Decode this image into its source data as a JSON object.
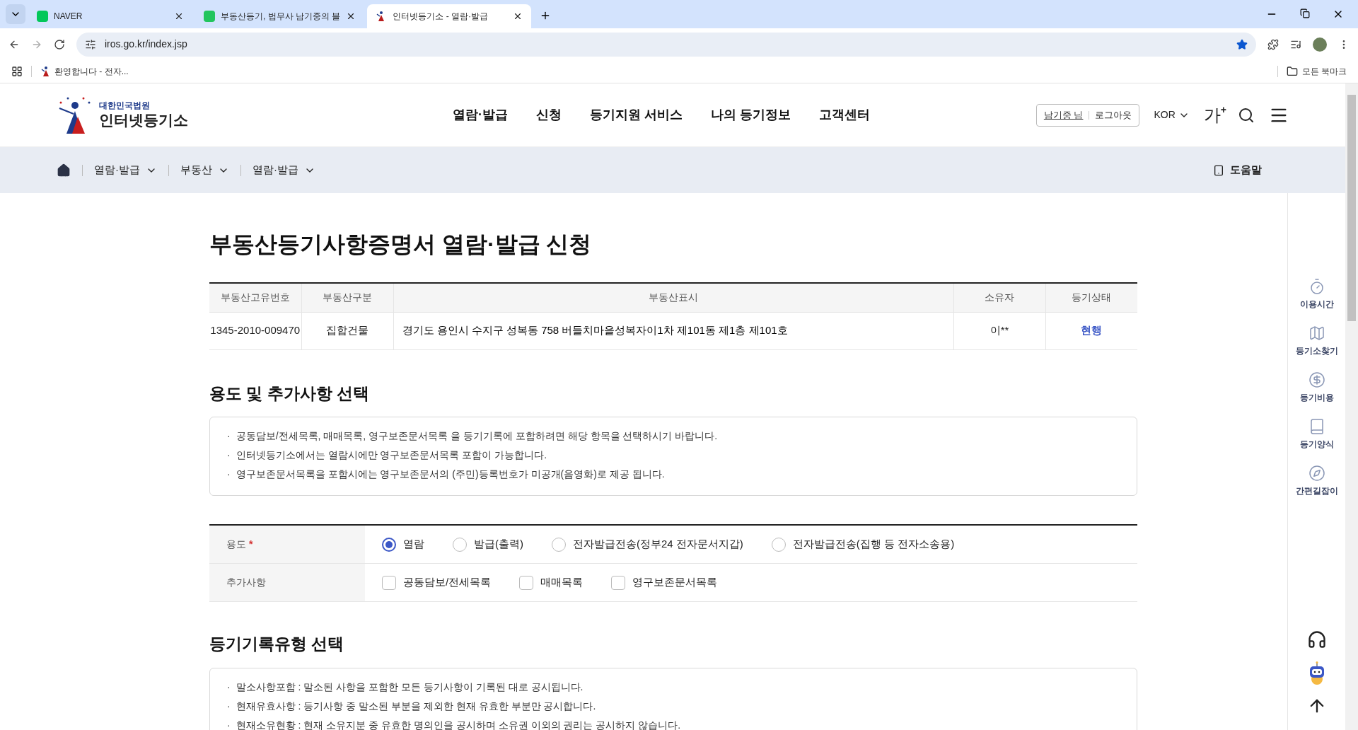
{
  "browser": {
    "tabs": [
      {
        "title": "NAVER",
        "selected": false,
        "kind": "naver"
      },
      {
        "title": "부동산등기, 법무사 남기중의 블",
        "selected": false,
        "kind": "blog"
      },
      {
        "title": "인터넷등기소 - 열람·발급",
        "selected": true,
        "kind": "site"
      }
    ],
    "address": "iros.go.kr/index.jsp",
    "bookmarks": [
      "환영합니다 - 전자..."
    ],
    "all_bookmarks": "모든 북마크"
  },
  "header": {
    "logo_small": "대한민국법원",
    "logo_large": "인터넷등기소",
    "nav": [
      "열람·발급",
      "신청",
      "등기지원 서비스",
      "나의 등기정보",
      "고객센터"
    ],
    "user": "남기중 님",
    "logout": "로그아웃",
    "language": "KOR",
    "font_size": {
      "label": "가",
      "sup": "+"
    }
  },
  "breadcrumb": {
    "items": [
      "열람·발급",
      "부동산",
      "열람·발급"
    ],
    "help": "도움말"
  },
  "page_title": "부동산등기사항증명서 열람·발급 신청",
  "property_table": {
    "columns": [
      "부동산고유번호",
      "부동산구분",
      "부동산표시",
      "소유자",
      "등기상태"
    ],
    "rows": [
      {
        "cells": [
          "1345-2010-009470",
          "집합건물",
          "경기도 용인시 수지구 성복동 758 버들치마을성복자이1차 제101동 제1층 제101호",
          "이**",
          "현행"
        ]
      }
    ]
  },
  "purpose_section": {
    "title": "용도 및 추가사항 선택",
    "notices": [
      "공동담보/전세목록, 매매목록, 영구보존문서목록 을 등기기록에 포함하려면 해당 항목을 선택하시기 바랍니다.",
      "인터넷등기소에서는 열람시에만 영구보존문서목록 포함이 가능합니다.",
      "영구보존문서목록을 포함시에는 영구보존문서의 (주민)등록번호가 미공개(음영화)로 제공 됩니다."
    ],
    "purpose": {
      "label": "용도",
      "required_mark": "*",
      "options": [
        {
          "label": "열람",
          "selected": true
        },
        {
          "label": "발급(출력)",
          "selected": false
        },
        {
          "label": "전자발급전송(정부24 전자문서지갑)",
          "selected": false
        },
        {
          "label": "전자발급전송(집행 등 전자소송용)",
          "selected": false
        }
      ]
    },
    "extras": {
      "label": "추가사항",
      "options": [
        {
          "label": "공동담보/전세목록",
          "checked": false
        },
        {
          "label": "매매목록",
          "checked": false
        },
        {
          "label": "영구보존문서목록",
          "checked": false
        }
      ]
    }
  },
  "record_type_section": {
    "title": "등기기록유형 선택",
    "notices": [
      "말소사항포함 : 말소된 사항을 포함한 모든 등기사항이 기록된 대로 공시됩니다.",
      "현재유효사항 : 등기사항 중 말소된 부분을 제외한 현재 유효한 부분만 공시합니다.",
      "현재소유현황 : 현재 소유지분 중 유효한 명의인을 공시하며 소유권 이외의 권리는 공시하지 않습니다."
    ]
  },
  "quick_menu": [
    {
      "label": "이용시간",
      "kind": "clock"
    },
    {
      "label": "등기소찾기",
      "kind": "map"
    },
    {
      "label": "등기비용",
      "kind": "coin"
    },
    {
      "label": "등기양식",
      "kind": "book"
    },
    {
      "label": "간편길잡이",
      "kind": "compass"
    }
  ],
  "bullet": "·"
}
